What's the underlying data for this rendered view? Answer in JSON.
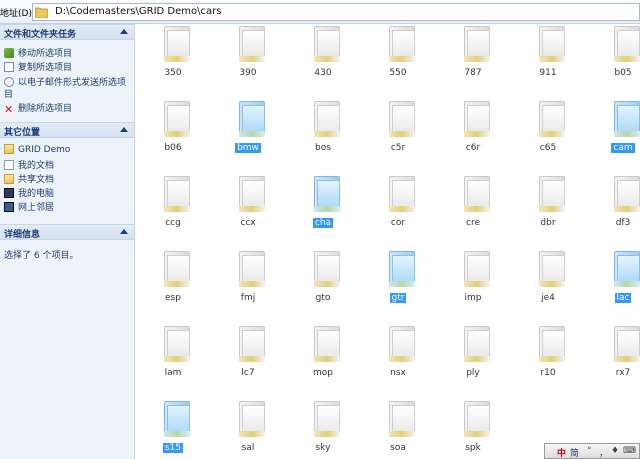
{
  "address": {
    "label": "地址(D)",
    "path": "D:\\Codemasters\\GRID Demo\\cars"
  },
  "tasks": {
    "title": "文件和文件夹任务",
    "items": [
      {
        "label": "移动所选项目",
        "icon": "move-icon"
      },
      {
        "label": "复制所选项目",
        "icon": "copy-icon"
      },
      {
        "label": "以电子邮件形式发送所选项",
        "label2": "目",
        "icon": "mail-icon"
      },
      {
        "label": "删除所选项目",
        "icon": "delete-icon"
      }
    ]
  },
  "places": {
    "title": "其它位置",
    "items": [
      {
        "label": "GRID Demo",
        "icon": "folder-icon"
      },
      {
        "label": "我的文档",
        "icon": "documents-icon"
      },
      {
        "label": "共享文档",
        "icon": "shared-folder-icon"
      },
      {
        "label": "我的电脑",
        "icon": "computer-icon"
      },
      {
        "label": "网上邻居",
        "icon": "network-icon"
      }
    ]
  },
  "details": {
    "title": "详细信息",
    "text": "选择了 6 个项目。"
  },
  "folders": [
    {
      "name": "350",
      "selected": false
    },
    {
      "name": "390",
      "selected": false
    },
    {
      "name": "430",
      "selected": false
    },
    {
      "name": "550",
      "selected": false
    },
    {
      "name": "787",
      "selected": false
    },
    {
      "name": "911",
      "selected": false
    },
    {
      "name": "b05",
      "selected": false
    },
    {
      "name": "b06",
      "selected": false
    },
    {
      "name": "bmw",
      "selected": true
    },
    {
      "name": "bos",
      "selected": false
    },
    {
      "name": "c5r",
      "selected": false
    },
    {
      "name": "c6r",
      "selected": false
    },
    {
      "name": "c65",
      "selected": false
    },
    {
      "name": "cam",
      "selected": true
    },
    {
      "name": "ccg",
      "selected": false
    },
    {
      "name": "ccx",
      "selected": false
    },
    {
      "name": "cha",
      "selected": true
    },
    {
      "name": "cor",
      "selected": false
    },
    {
      "name": "cre",
      "selected": false
    },
    {
      "name": "dbr",
      "selected": false
    },
    {
      "name": "df3",
      "selected": false
    },
    {
      "name": "esp",
      "selected": false
    },
    {
      "name": "fmj",
      "selected": false
    },
    {
      "name": "gto",
      "selected": false
    },
    {
      "name": "gtr",
      "selected": true
    },
    {
      "name": "imp",
      "selected": false
    },
    {
      "name": "je4",
      "selected": false
    },
    {
      "name": "lac",
      "selected": true
    },
    {
      "name": "lam",
      "selected": false
    },
    {
      "name": "lc7",
      "selected": false
    },
    {
      "name": "mop",
      "selected": false
    },
    {
      "name": "nsx",
      "selected": false
    },
    {
      "name": "ply",
      "selected": false
    },
    {
      "name": "r10",
      "selected": false
    },
    {
      "name": "rx7",
      "selected": false
    },
    {
      "name": "s15",
      "selected": true
    },
    {
      "name": "sal",
      "selected": false
    },
    {
      "name": "sky",
      "selected": false
    },
    {
      "name": "soa",
      "selected": false
    },
    {
      "name": "spk",
      "selected": false
    }
  ],
  "ime": {
    "mode": "中",
    "variant": "简",
    "extra": [
      "°",
      "，",
      "♦",
      "⌨"
    ]
  }
}
